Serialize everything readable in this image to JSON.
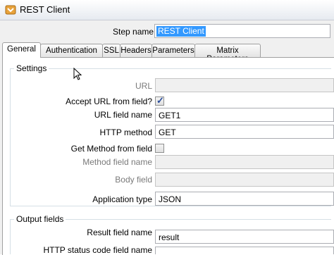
{
  "window": {
    "title": "REST Client",
    "icon": "rest-client-app-icon"
  },
  "step": {
    "label": "Step name",
    "value": "REST Client"
  },
  "tabs": [
    {
      "label": "General",
      "active": true
    },
    {
      "label": "Authentication",
      "active": false
    },
    {
      "label": "SSL",
      "active": false
    },
    {
      "label": "Headers",
      "active": false
    },
    {
      "label": "Parameters",
      "active": false
    },
    {
      "label": "Matrix Parameters",
      "active": false
    }
  ],
  "settings": {
    "title": "Settings",
    "url": {
      "label": "URL",
      "value": ""
    },
    "accept_url": {
      "label": "Accept URL from field?",
      "checked": true
    },
    "url_field_name": {
      "label": "URL field name",
      "value": "GET1"
    },
    "http_method": {
      "label": "HTTP method",
      "value": "GET"
    },
    "get_method": {
      "label": "Get Method from field",
      "checked": false
    },
    "method_field_name": {
      "label": "Method field name",
      "value": ""
    },
    "body_field": {
      "label": "Body field",
      "value": ""
    },
    "application_type": {
      "label": "Application type",
      "value": "JSON"
    }
  },
  "output": {
    "title": "Output fields",
    "result_field": {
      "label": "Result field name",
      "value": "result"
    },
    "http_status": {
      "label": "HTTP status code field name",
      "value": ""
    }
  }
}
